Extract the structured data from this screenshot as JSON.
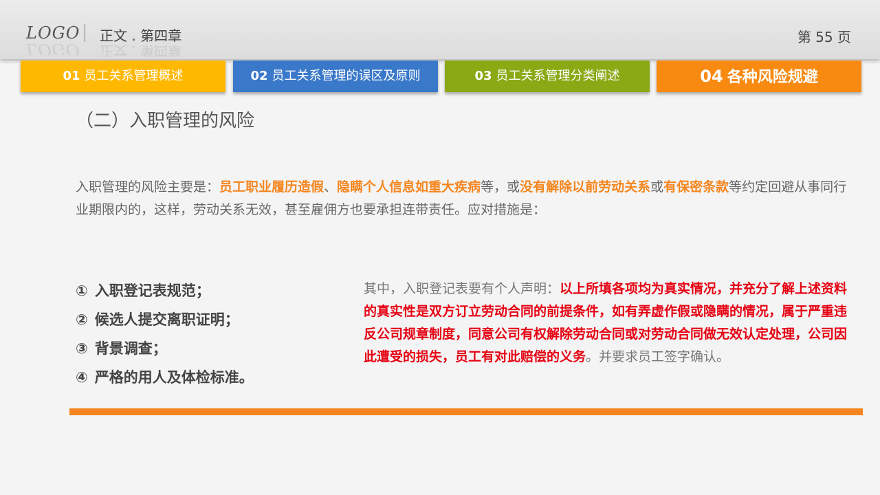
{
  "header": {
    "logo": "LOGO",
    "chapter": "正文 . 第四章",
    "page": "第 55 页"
  },
  "tabs": [
    {
      "num": "01",
      "label": "员工关系管理概述",
      "color": "#ffb800",
      "active": false
    },
    {
      "num": "02",
      "label": "员工关系管理的误区及原则",
      "color": "#3a78c9",
      "active": false
    },
    {
      "num": "03",
      "label": "员工关系管理分类阐述",
      "color": "#8aa915",
      "active": false
    },
    {
      "num": "04",
      "label": "各种风险规避",
      "color": "#f88a12",
      "active": true
    }
  ],
  "section_title": "（二）入职管理的风险",
  "intro": {
    "lead": "入职管理的风险主要是：",
    "h1": "员工职业履历造假",
    "sep1": "、",
    "h2": "隐瞒个人信息如重大疾病",
    "sep2": "等，或",
    "h3": "没有解除以前劳动关系",
    "sep3": "或",
    "h4": "有保密条款",
    "tail": "等约定回避从事同行业期限内的，这样，劳动关系无效，甚至雇佣方也要承担连带责任。应对措施是："
  },
  "measures": [
    {
      "marker": "①",
      "text": "入职登记表规范；"
    },
    {
      "marker": "②",
      "text": "候选人提交离职证明；"
    },
    {
      "marker": "③",
      "text": "背景调查；"
    },
    {
      "marker": "④",
      "text": "严格的用人及体检标准。"
    }
  ],
  "declaration": {
    "lead": "其中，入职登记表要有个人声明：",
    "highlight": "以上所填各项均为真实情况，并充分了解上述资料的真实性是双方订立劳动合同的前提条件，如有弄虚作假或隐瞒的情况，属于严重违反公司规章制度，同意公司有权解除劳动合同或对劳动合同做无效认定处理，公司因此遭受的损失，员工有对此赔偿的义务",
    "tail": "。并要求员工签字确认。"
  },
  "colors": {
    "accent_orange": "#f5861f",
    "accent_red": "#e60012"
  }
}
